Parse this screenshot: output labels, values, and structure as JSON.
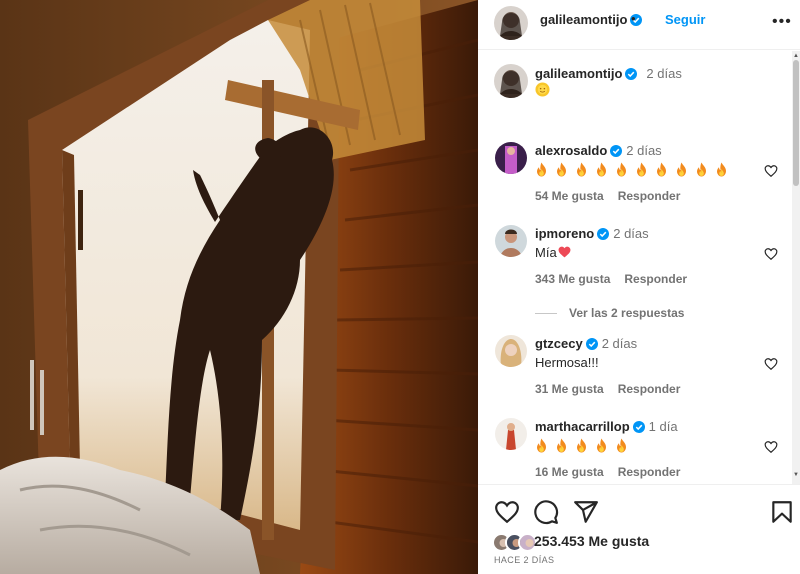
{
  "post": {
    "author": "galileamontijo",
    "follow_label": "Seguir",
    "separator": "•",
    "more_label": "•••",
    "caption": {
      "username": "galileamontijo",
      "time": "2 días",
      "text": "🌞"
    }
  },
  "comments": [
    {
      "username": "alexrosaldo",
      "time": "2 días",
      "text": "🔥🔥🔥🔥🔥🔥🔥🔥🔥🔥",
      "fire_count": 10,
      "likes": "54 Me gusta",
      "reply_label": "Responder"
    },
    {
      "username": "ipmoreno",
      "time": "2 días",
      "text": "Mía",
      "emoji": "❤️",
      "likes": "343 Me gusta",
      "reply_label": "Responder",
      "view_replies": "Ver las 2 respuestas"
    },
    {
      "username": "gtzcecy",
      "time": "2 días",
      "text": "Hermosa!!!",
      "likes": "31 Me gusta",
      "reply_label": "Responder"
    },
    {
      "username": "marthacarrillop",
      "time": "1 día",
      "text": "🔥🔥🔥🔥🔥",
      "fire_count": 5,
      "likes": "16 Me gusta",
      "reply_label": "Responder"
    }
  ],
  "actions": {
    "like_icon": "heart-icon",
    "comment_icon": "comment-icon",
    "share_icon": "send-icon",
    "save_icon": "bookmark-icon"
  },
  "likes_summary": "253.453 Me gusta",
  "post_date": "HACE 2 DÍAS",
  "colors": {
    "accent": "#0095f6",
    "text": "#262626",
    "muted": "#737373",
    "verified": "#0095f6",
    "heart_red": "#ed4956"
  }
}
